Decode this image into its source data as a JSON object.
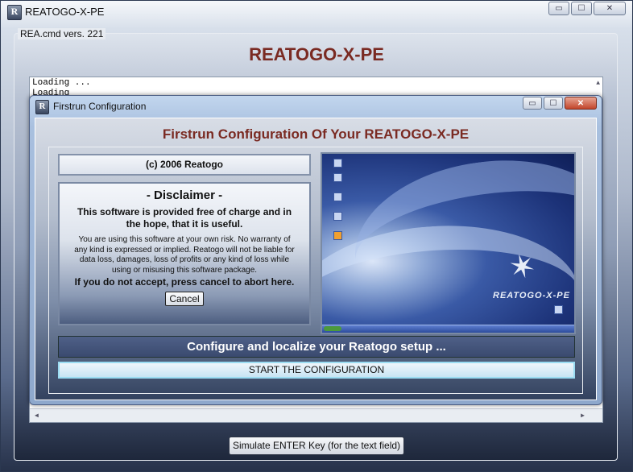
{
  "window": {
    "title": "REATOGO-X-PE",
    "icon_letter": "R",
    "minimize_label": "▭",
    "maximize_label": "☐",
    "close_label": "✕"
  },
  "group": {
    "label": "REA.cmd vers. 221"
  },
  "main": {
    "title": "REATOGO-X-PE",
    "log_lines": [
      "Loading ...",
      "Loading"
    ],
    "simulate_button": "Simulate ENTER Key  (for the text field)"
  },
  "dialog": {
    "title": "Firstrun Configuration",
    "icon_letter": "R",
    "heading": "Firstrun Configuration Of Your REATOGO-X-PE",
    "copyright": "(c) 2006 Reatogo",
    "disclaimer": {
      "title": "- Disclaimer -",
      "lead": "This software is provided free of charge and in the hope, that it is useful.",
      "body": "You are using this software at your own risk. No warranty of any kind is expressed or implied. Reatogo will not be liable for data loss, damages, loss of profits or any kind of loss while using or misusing this software package.",
      "final": "If you do not accept, press cancel to abort here.",
      "cancel_button": "Cancel"
    },
    "screenshot": {
      "logo_text": "REATOGO-X-PE"
    },
    "configure_text": "Configure and localize your Reatogo setup ...",
    "start_button": "START THE CONFIGURATION"
  }
}
